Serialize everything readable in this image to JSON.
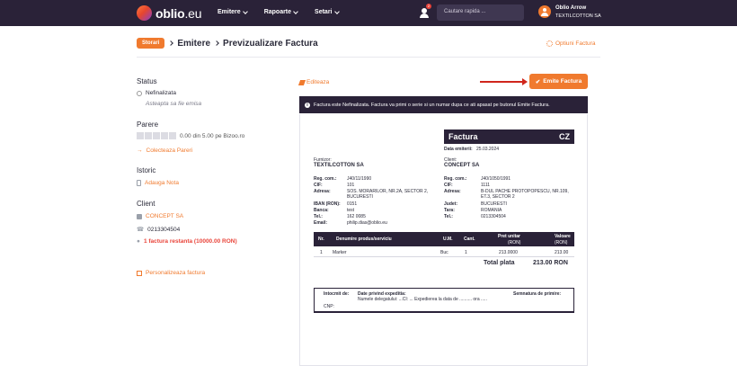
{
  "nav": {
    "brand": "oblio",
    "brand_suffix": ".eu",
    "menu": [
      "Emitere",
      "Rapoarte",
      "Setari"
    ],
    "notif_count": "2",
    "search_placeholder": "Cautare rapida ...",
    "user_name": "Oblio Arrow",
    "user_company": "TEXTILCOTTON SA"
  },
  "breadcrumb": {
    "pill": "Storari",
    "section": "Emitere",
    "page": "Previzualizare Factura",
    "options": "Optiuni Factura"
  },
  "sidebar": {
    "status_title": "Status",
    "status_value": "Nefinalizata",
    "status_note": "Asteapta sa fie emisa",
    "reviews_title": "Parere",
    "reviews_score": "0.00 din 5.00 pe Bizoo.ro",
    "reviews_link": "Colecteaza Pareri",
    "history_title": "Istoric",
    "history_link": "Adauga Nota",
    "client_title": "Client",
    "client_name": "CONCEPT SA",
    "client_phone": "0213304504",
    "client_overdue": "1 factura restanta (10000.00 RON)",
    "customize_link": "Personalizeaza factura"
  },
  "actions": {
    "edit": "Editeaza",
    "emit": "Emite Factura"
  },
  "notice": "Factura este Nefinalizata. Factura va primi o serie si un numar dupa ce ati apasat pe butonul Emite Factura.",
  "invoice": {
    "title": "Factura",
    "series": "CZ",
    "date_label": "Data emiterii:",
    "date": "25.03.2024",
    "supplier_label": "Furnizor:",
    "supplier_name": "TEXTILCOTTON SA",
    "client_label": "Client:",
    "client_name": "CONCEPT SA",
    "supplier_fields": [
      {
        "k": "Reg. com.:",
        "v": "J40/11/1990"
      },
      {
        "k": "CIF:",
        "v": "101"
      },
      {
        "k": "Adresa:",
        "v": "SOS. MORARILOR, NR.2A, SECTOR 2,"
      },
      {
        "k": "",
        "v": "BUCURESTI"
      },
      {
        "k": "IBAN (RON):",
        "v": "0151"
      },
      {
        "k": "Banca:",
        "v": "test"
      },
      {
        "k": "Tel.:",
        "v": "162 0085"
      },
      {
        "k": "Email:",
        "v": "philip.dias@oblio.eu"
      }
    ],
    "client_fields": [
      {
        "k": "Reg. com.:",
        "v": "J40/1050/1991"
      },
      {
        "k": "CIF:",
        "v": "1111"
      },
      {
        "k": "Adresa:",
        "v": "B-DUL PACHE PROTOPOPESCU, NR.109,"
      },
      {
        "k": "",
        "v": "ET.3, SECTOR 2"
      },
      {
        "k": "Judet:",
        "v": "BUCURESTI"
      },
      {
        "k": "Tara:",
        "v": "ROMANIA"
      },
      {
        "k": "Tel.:",
        "v": "0213304504"
      }
    ],
    "columns": [
      "Nr.",
      "Denumire produs/serviciu",
      "U.M.",
      "Cant.",
      "Pret unitar",
      "Valoare"
    ],
    "col_units": [
      "(RON)",
      "(RON)"
    ],
    "items": [
      {
        "nr": "1",
        "name": "Marker",
        "um": "Buc",
        "qty": "1",
        "price": "213.0000",
        "value": "213.00"
      }
    ],
    "total_label": "Total plata",
    "total_value": "213.00 RON",
    "footer": {
      "issued_label": "Intocmit de:",
      "cnp": "CNP:",
      "delivery_label": "Date privind expeditia:",
      "delivery_text": "Numele delegatului: ...CI: ... Expedierea la data de .......... ora .....",
      "signature_label": "Semnatura de primire:"
    }
  }
}
